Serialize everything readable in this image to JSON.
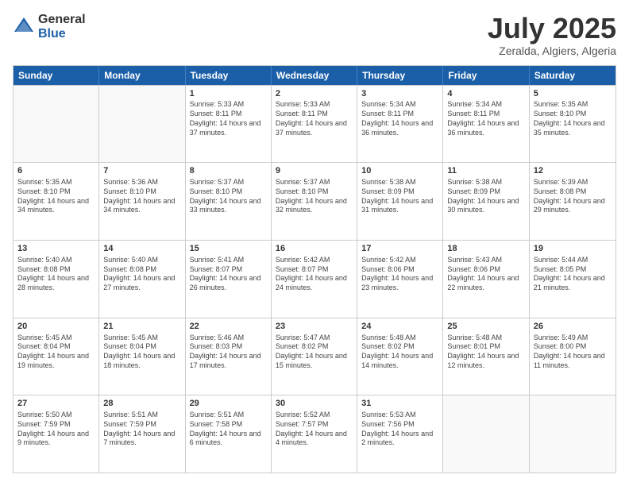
{
  "logo": {
    "general": "General",
    "blue": "Blue"
  },
  "title": "July 2025",
  "location": "Zeralda, Algiers, Algeria",
  "days_of_week": [
    "Sunday",
    "Monday",
    "Tuesday",
    "Wednesday",
    "Thursday",
    "Friday",
    "Saturday"
  ],
  "weeks": [
    [
      {
        "day": "",
        "content": ""
      },
      {
        "day": "",
        "content": ""
      },
      {
        "day": "1",
        "content": "Sunrise: 5:33 AM\nSunset: 8:11 PM\nDaylight: 14 hours and 37 minutes."
      },
      {
        "day": "2",
        "content": "Sunrise: 5:33 AM\nSunset: 8:11 PM\nDaylight: 14 hours and 37 minutes."
      },
      {
        "day": "3",
        "content": "Sunrise: 5:34 AM\nSunset: 8:11 PM\nDaylight: 14 hours and 36 minutes."
      },
      {
        "day": "4",
        "content": "Sunrise: 5:34 AM\nSunset: 8:11 PM\nDaylight: 14 hours and 36 minutes."
      },
      {
        "day": "5",
        "content": "Sunrise: 5:35 AM\nSunset: 8:10 PM\nDaylight: 14 hours and 35 minutes."
      }
    ],
    [
      {
        "day": "6",
        "content": "Sunrise: 5:35 AM\nSunset: 8:10 PM\nDaylight: 14 hours and 34 minutes."
      },
      {
        "day": "7",
        "content": "Sunrise: 5:36 AM\nSunset: 8:10 PM\nDaylight: 14 hours and 34 minutes."
      },
      {
        "day": "8",
        "content": "Sunrise: 5:37 AM\nSunset: 8:10 PM\nDaylight: 14 hours and 33 minutes."
      },
      {
        "day": "9",
        "content": "Sunrise: 5:37 AM\nSunset: 8:10 PM\nDaylight: 14 hours and 32 minutes."
      },
      {
        "day": "10",
        "content": "Sunrise: 5:38 AM\nSunset: 8:09 PM\nDaylight: 14 hours and 31 minutes."
      },
      {
        "day": "11",
        "content": "Sunrise: 5:38 AM\nSunset: 8:09 PM\nDaylight: 14 hours and 30 minutes."
      },
      {
        "day": "12",
        "content": "Sunrise: 5:39 AM\nSunset: 8:08 PM\nDaylight: 14 hours and 29 minutes."
      }
    ],
    [
      {
        "day": "13",
        "content": "Sunrise: 5:40 AM\nSunset: 8:08 PM\nDaylight: 14 hours and 28 minutes."
      },
      {
        "day": "14",
        "content": "Sunrise: 5:40 AM\nSunset: 8:08 PM\nDaylight: 14 hours and 27 minutes."
      },
      {
        "day": "15",
        "content": "Sunrise: 5:41 AM\nSunset: 8:07 PM\nDaylight: 14 hours and 26 minutes."
      },
      {
        "day": "16",
        "content": "Sunrise: 5:42 AM\nSunset: 8:07 PM\nDaylight: 14 hours and 24 minutes."
      },
      {
        "day": "17",
        "content": "Sunrise: 5:42 AM\nSunset: 8:06 PM\nDaylight: 14 hours and 23 minutes."
      },
      {
        "day": "18",
        "content": "Sunrise: 5:43 AM\nSunset: 8:06 PM\nDaylight: 14 hours and 22 minutes."
      },
      {
        "day": "19",
        "content": "Sunrise: 5:44 AM\nSunset: 8:05 PM\nDaylight: 14 hours and 21 minutes."
      }
    ],
    [
      {
        "day": "20",
        "content": "Sunrise: 5:45 AM\nSunset: 8:04 PM\nDaylight: 14 hours and 19 minutes."
      },
      {
        "day": "21",
        "content": "Sunrise: 5:45 AM\nSunset: 8:04 PM\nDaylight: 14 hours and 18 minutes."
      },
      {
        "day": "22",
        "content": "Sunrise: 5:46 AM\nSunset: 8:03 PM\nDaylight: 14 hours and 17 minutes."
      },
      {
        "day": "23",
        "content": "Sunrise: 5:47 AM\nSunset: 8:02 PM\nDaylight: 14 hours and 15 minutes."
      },
      {
        "day": "24",
        "content": "Sunrise: 5:48 AM\nSunset: 8:02 PM\nDaylight: 14 hours and 14 minutes."
      },
      {
        "day": "25",
        "content": "Sunrise: 5:48 AM\nSunset: 8:01 PM\nDaylight: 14 hours and 12 minutes."
      },
      {
        "day": "26",
        "content": "Sunrise: 5:49 AM\nSunset: 8:00 PM\nDaylight: 14 hours and 11 minutes."
      }
    ],
    [
      {
        "day": "27",
        "content": "Sunrise: 5:50 AM\nSunset: 7:59 PM\nDaylight: 14 hours and 9 minutes."
      },
      {
        "day": "28",
        "content": "Sunrise: 5:51 AM\nSunset: 7:59 PM\nDaylight: 14 hours and 7 minutes."
      },
      {
        "day": "29",
        "content": "Sunrise: 5:51 AM\nSunset: 7:58 PM\nDaylight: 14 hours and 6 minutes."
      },
      {
        "day": "30",
        "content": "Sunrise: 5:52 AM\nSunset: 7:57 PM\nDaylight: 14 hours and 4 minutes."
      },
      {
        "day": "31",
        "content": "Sunrise: 5:53 AM\nSunset: 7:56 PM\nDaylight: 14 hours and 2 minutes."
      },
      {
        "day": "",
        "content": ""
      },
      {
        "day": "",
        "content": ""
      }
    ]
  ]
}
